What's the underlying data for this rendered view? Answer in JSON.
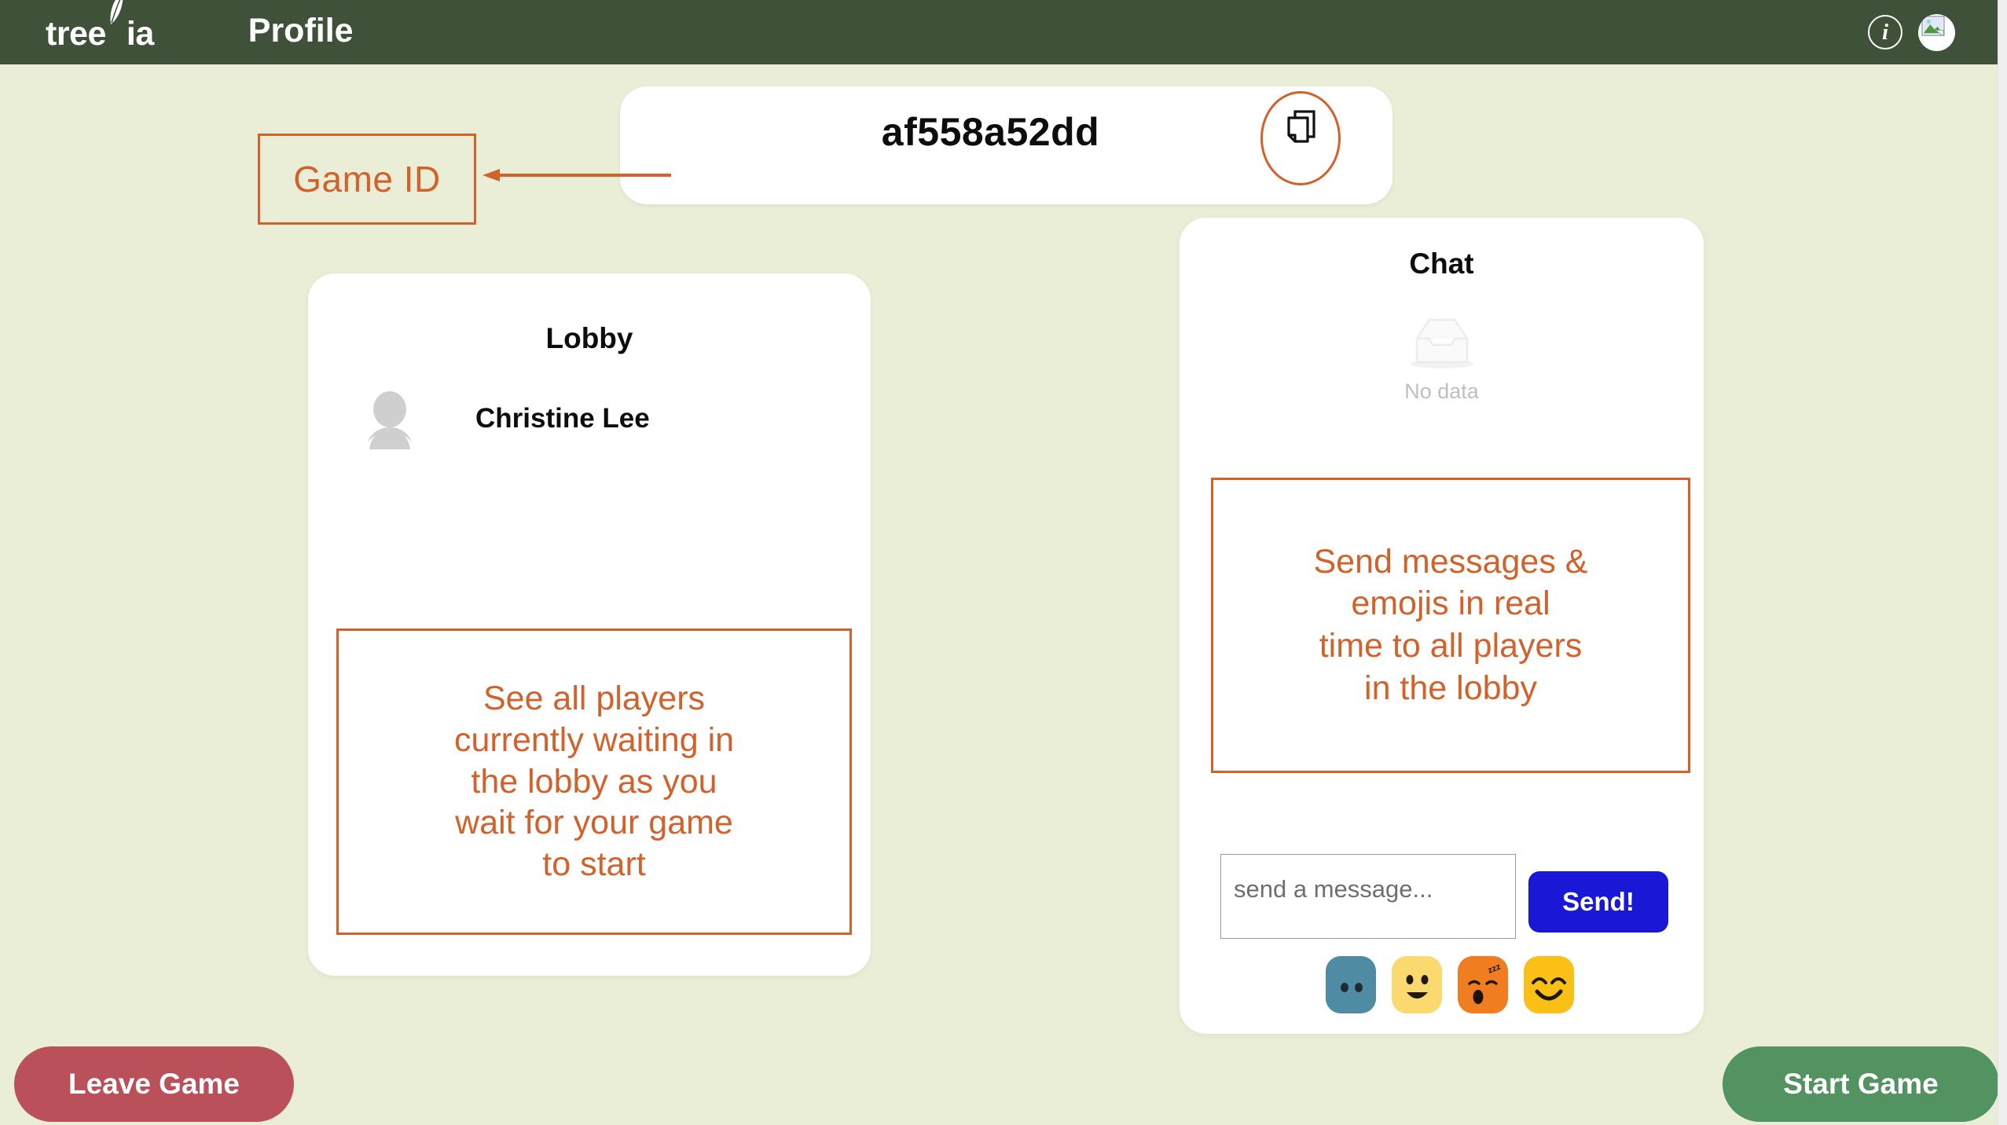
{
  "topbar": {
    "brand_pre": "tree",
    "brand_post": "ia",
    "profile_label": "Profile",
    "info_icon_glyph": "i",
    "bg_color": "#3f5138"
  },
  "game_id": {
    "value": "af558a52dd",
    "copy_icon": "copy-icon"
  },
  "annotations": {
    "accent_color": "#d2622c",
    "game_id_label": "Game ID",
    "lobby_note": "See all players\ncurrently waiting in\nthe lobby as you\nwait for your game\nto start",
    "chat_note": "Send messages &\nemojis in real\ntime to all players\nin the lobby"
  },
  "lobby": {
    "title": "Lobby",
    "players": [
      {
        "name": "Christine Lee",
        "avatar": "person-avatar-icon"
      }
    ]
  },
  "chat": {
    "title": "Chat",
    "empty_icon": "empty-inbox-icon",
    "empty_label": "No data",
    "input_placeholder": "send a message...",
    "input_value": "",
    "send_label": "Send!",
    "send_color": "#1a18d6",
    "emojis": [
      {
        "name": "emoji-neutral-blank",
        "color": "#4f8ba3"
      },
      {
        "name": "emoji-grinning",
        "color": "#fada6e"
      },
      {
        "name": "emoji-sleeping",
        "color": "#f07e20"
      },
      {
        "name": "emoji-smiling-eyes",
        "color": "#fbc016"
      }
    ]
  },
  "footer": {
    "leave_label": "Leave Game",
    "leave_color": "#b9505a",
    "start_label": "Start Game",
    "start_color": "#539261"
  },
  "page": {
    "background_color": "#eaeed6"
  }
}
